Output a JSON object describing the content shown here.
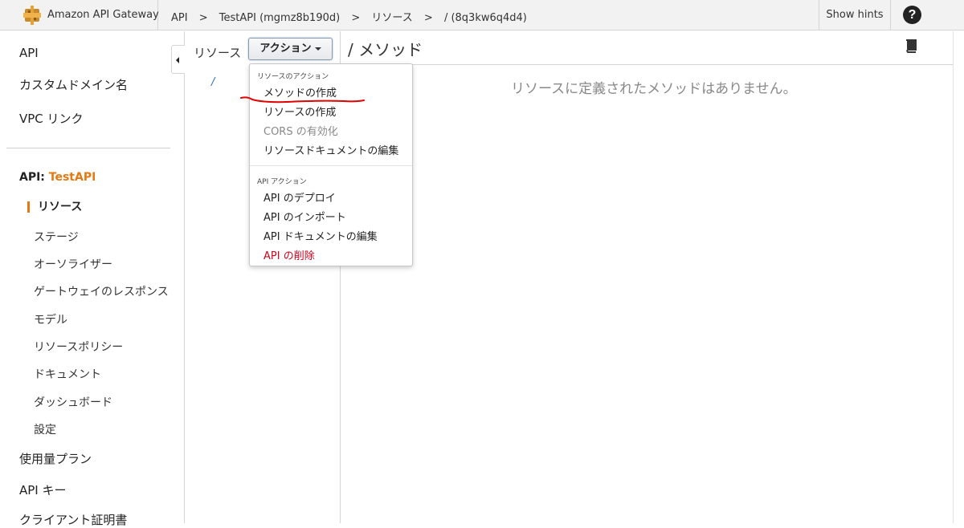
{
  "header": {
    "brand": "Amazon API Gateway",
    "breadcrumbs": [
      "API",
      "TestAPI (mgmz8b190d)",
      "リソース",
      "/ (8q3kw6q4d4)"
    ],
    "separator": ">",
    "show_hints": "Show hints",
    "help_glyph": "?"
  },
  "sidebar": {
    "top_items": [
      {
        "label": "API"
      },
      {
        "label": "カスタムドメイン名"
      },
      {
        "label": "VPC リンク"
      }
    ],
    "api_prefix": "API:",
    "api_name": "TestAPI",
    "sub_items": [
      {
        "label": "リソース"
      },
      {
        "label": "ステージ"
      },
      {
        "label": "オーソライザー"
      },
      {
        "label": "ゲートウェイのレスポンス"
      },
      {
        "label": "モデル"
      },
      {
        "label": "リソースポリシー"
      },
      {
        "label": "ドキュメント"
      },
      {
        "label": "ダッシュボード"
      },
      {
        "label": "設定"
      }
    ],
    "bottom_items": [
      {
        "label": "使用量プラン"
      },
      {
        "label": "API キー"
      },
      {
        "label": "クライアント証明書"
      }
    ]
  },
  "resources": {
    "label": "リソース",
    "actions_button": "アクション",
    "root": "/"
  },
  "methods": {
    "title": "/ メソッド",
    "empty_message": "リソースに定義されたメソッドはありません。"
  },
  "actions_menu": {
    "resource_heading": "リソースのアクション",
    "resource_items": [
      {
        "label": "メソッドの作成"
      },
      {
        "label": "リソースの作成"
      },
      {
        "label": "CORS の有効化"
      },
      {
        "label": "リソースドキュメントの編集"
      }
    ],
    "api_heading": "API アクション",
    "api_items": [
      {
        "label": "API のデプロイ"
      },
      {
        "label": "API のインポート"
      },
      {
        "label": "API ドキュメントの編集"
      },
      {
        "label": "API の削除"
      }
    ]
  },
  "colors": {
    "accent_orange": "#e47911",
    "danger_red": "#d0021b",
    "link_blue": "#2a6ebb",
    "annotation_red": "#e00000"
  },
  "icons": {
    "logo": "api-gateway-logo",
    "help": "question-circle-icon",
    "collapse": "caret-left-icon",
    "book": "book-icon"
  }
}
